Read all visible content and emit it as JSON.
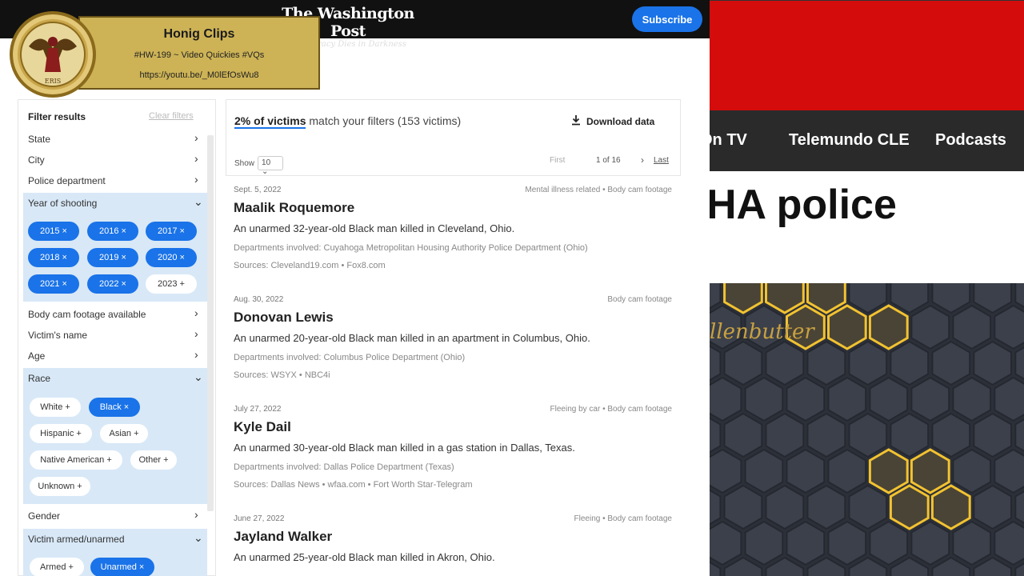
{
  "header": {
    "masthead": "The Washington Post",
    "tagline": "Democracy Dies in Darkness",
    "subscribe": "Subscribe"
  },
  "overlay": {
    "title": "Honig Clips",
    "line1": "#HW-199 ~ Video Quickies #VQs",
    "line2": "https://youtu.be/_M0lEfOsWu8",
    "medal_text": "ERIS"
  },
  "sidebar": {
    "heading": "Filter results",
    "clear": "Clear filters",
    "rows": [
      "State",
      "City",
      "Police department"
    ],
    "year": {
      "label": "Year of shooting",
      "chips": [
        {
          "label": "2015 ×",
          "on": true
        },
        {
          "label": "2016 ×",
          "on": true
        },
        {
          "label": "2017 ×",
          "on": true
        },
        {
          "label": "2018 ×",
          "on": true
        },
        {
          "label": "2019 ×",
          "on": true
        },
        {
          "label": "2020 ×",
          "on": true
        },
        {
          "label": "2021 ×",
          "on": true
        },
        {
          "label": "2022 ×",
          "on": true
        },
        {
          "label": "2023 +",
          "on": false
        }
      ]
    },
    "rows2": [
      "Body cam footage available",
      "Victim's name",
      "Age"
    ],
    "race": {
      "label": "Race",
      "chips": [
        {
          "label": "White +",
          "on": false
        },
        {
          "label": "Black ×",
          "on": true
        },
        {
          "label": "Hispanic +",
          "on": false
        },
        {
          "label": "Asian +",
          "on": false
        },
        {
          "label": "Native American +",
          "on": false
        },
        {
          "label": "Other +",
          "on": false
        },
        {
          "label": "Unknown +",
          "on": false
        }
      ]
    },
    "gender": "Gender",
    "armed": {
      "label": "Victim armed/unarmed",
      "chips": [
        {
          "label": "Armed +",
          "on": false
        },
        {
          "label": "Unarmed ×",
          "on": true
        }
      ]
    }
  },
  "results": {
    "summary_hl": "2% of victims",
    "summary_rest": " match your filters (153 victims)",
    "download": "Download data",
    "show_label": "Show",
    "show_value": "10",
    "first": "First",
    "page": "1 of 16",
    "last": "Last"
  },
  "victims": [
    {
      "date": "Sept. 5, 2022",
      "tags": "Mental illness related • Body cam footage",
      "name": "Maalik Roquemore",
      "desc": "An unarmed 32-year-old Black man killed in Cleveland, Ohio.",
      "dept": "Departments involved: Cuyahoga Metropolitan Housing Authority Police Department (Ohio)",
      "src": "Sources: Cleveland19.com • Fox8.com"
    },
    {
      "date": "Aug. 30, 2022",
      "tags": "Body cam footage",
      "name": "Donovan Lewis",
      "desc": "An unarmed 20-year-old Black man killed in an apartment in Columbus, Ohio.",
      "dept": "Departments involved: Columbus Police Department (Ohio)",
      "src": "Sources: WSYX • NBC4i"
    },
    {
      "date": "July 27, 2022",
      "tags": "Fleeing by car • Body cam footage",
      "name": "Kyle Dail",
      "desc": "An unarmed 30-year-old Black man killed in a gas station in Dallas, Texas.",
      "dept": "Departments involved: Dallas Police Department (Texas)",
      "src": "Sources: Dallas News • wfaa.com • Fort Worth Star-Telegram"
    },
    {
      "date": "June 27, 2022",
      "tags": "Fleeing • Body cam footage",
      "name": "Jayland Walker",
      "desc": "An unarmed 25-year-old Black man killed in Akron, Ohio.",
      "dept": "",
      "src": ""
    }
  ],
  "right": {
    "nav": [
      "On TV",
      "Telemundo CLE",
      "Podcasts"
    ],
    "headline": "HA police",
    "logo": "llenbutter"
  },
  "colors": {
    "accent": "#1a73e8",
    "chip_panel": "#d8e8f7",
    "red_banner": "#d40c0c",
    "hex_glow": "#f2c230"
  }
}
